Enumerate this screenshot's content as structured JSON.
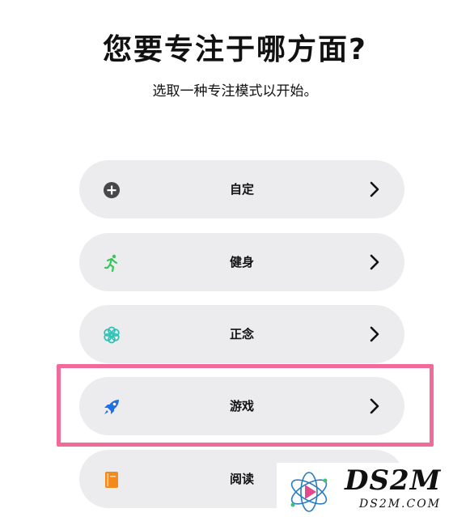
{
  "header": {
    "title": "您要专注于哪方面?",
    "subtitle": "选取一种专注模式以开始。"
  },
  "options": [
    {
      "label": "自定",
      "icon": "plus-circle-icon",
      "icon_color": "#48484a"
    },
    {
      "label": "健身",
      "icon": "running-figure-icon",
      "icon_color": "#34c759"
    },
    {
      "label": "正念",
      "icon": "flower-icon",
      "icon_color": "#30c2b5"
    },
    {
      "label": "游戏",
      "icon": "rocket-icon",
      "icon_color": "#1f6fe8"
    },
    {
      "label": "阅读",
      "icon": "book-icon",
      "icon_color": "#f28a1c"
    }
  ],
  "highlight_color": "#f06a9a",
  "watermark": {
    "brand": "DS2M",
    "domain": "DS2M.COM"
  }
}
